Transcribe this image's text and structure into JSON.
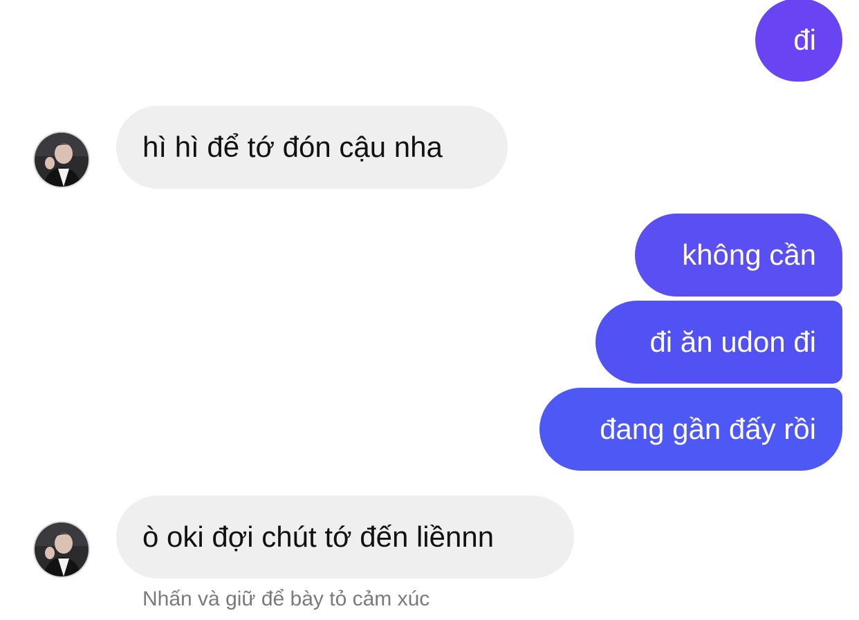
{
  "messages": [
    {
      "id": "m1",
      "direction": "outgoing",
      "text": "đi"
    },
    {
      "id": "m2",
      "direction": "incoming",
      "text": "hì hì để tớ đón cậu nha"
    },
    {
      "id": "m3",
      "direction": "outgoing",
      "text": "không cần"
    },
    {
      "id": "m4",
      "direction": "outgoing",
      "text": "đi ăn udon đi"
    },
    {
      "id": "m5",
      "direction": "outgoing",
      "text": "đang gần đấy rồi"
    },
    {
      "id": "m6",
      "direction": "incoming",
      "text": "ò oki đợi chút tớ đến liềnnn"
    }
  ],
  "reaction_hint": "Nhấn và giữ để bày tỏ cảm xúc",
  "colors": {
    "outgoing_top": "#6d43f2",
    "outgoing_bottom": "#4e59f4",
    "incoming_bubble": "#efefef",
    "hint_text": "#7a7a7a"
  },
  "icons": {
    "contact_avatar": "avatar"
  }
}
